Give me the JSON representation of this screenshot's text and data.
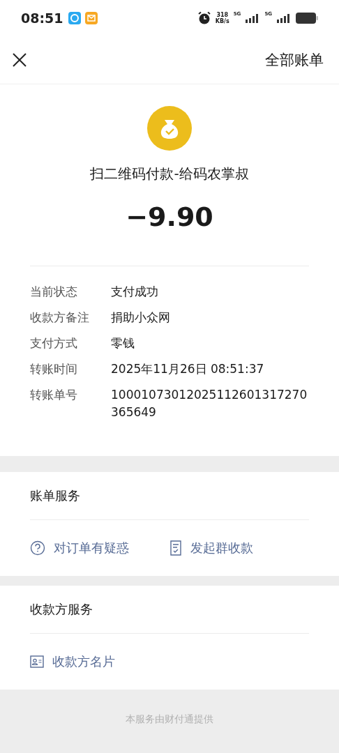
{
  "status_bar": {
    "time": "08:51",
    "speed_value": "318",
    "speed_unit": "KB/s",
    "network_1": "5G",
    "network_2": "5G"
  },
  "nav": {
    "action": "全部账单"
  },
  "payment": {
    "title": "扫二维码付款-给码农掌叔",
    "amount": "−9.90"
  },
  "details": [
    {
      "label": "当前状态",
      "value": "支付成功"
    },
    {
      "label": "收款方备注",
      "value": "捐助小众网"
    },
    {
      "label": "支付方式",
      "value": "零钱"
    },
    {
      "label": "转账时间",
      "value": "2025年11月26日 08:51:37"
    },
    {
      "label": "转账单号",
      "value": "10001073012025112601317270365649"
    }
  ],
  "sections": [
    {
      "title": "账单服务",
      "links": [
        {
          "kind": "question",
          "label": "对订单有疑惑"
        },
        {
          "kind": "receipt",
          "label": "发起群收款"
        }
      ]
    },
    {
      "title": "收款方服务",
      "links": [
        {
          "kind": "card",
          "label": "收款方名片"
        }
      ]
    }
  ],
  "footer": "本服务由财付通提供"
}
